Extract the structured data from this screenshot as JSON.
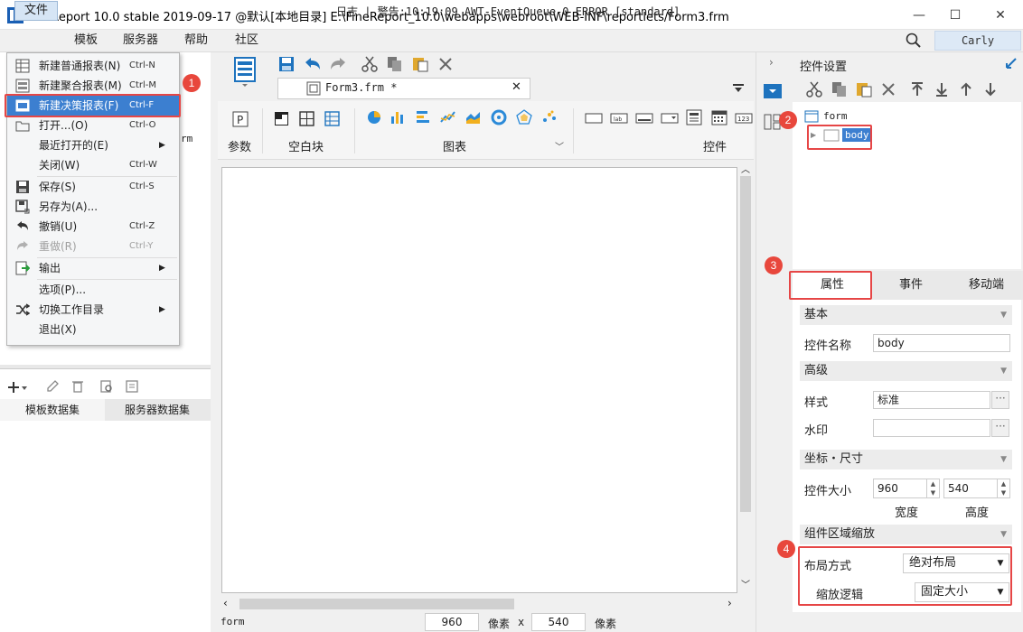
{
  "window": {
    "title": "FineReport 10.0 stable 2019-09-17 @默认[本地目录]    E:\\FineReport_10.0\\webapps\\webroot\\WEB-INF\\reportlets/Form3.frm",
    "minimize": "—",
    "maximize": "☐",
    "close": "✕"
  },
  "menubar": {
    "items": [
      "文件",
      "模板",
      "服务器",
      "帮助",
      "社区"
    ],
    "log": "日志 | 警告:10:19:09 AWT-EventQueue-0 ERROR [standard]",
    "user": "Carly"
  },
  "file_menu": {
    "items": [
      {
        "label": "新建普通报表(N)",
        "shortcut": "Ctrl-N"
      },
      {
        "label": "新建聚合报表(M)",
        "shortcut": "Ctrl-M"
      },
      {
        "label": "新建决策报表(F)",
        "shortcut": "Ctrl-F"
      },
      {
        "label": "打开...(O)",
        "shortcut": "Ctrl-O"
      },
      {
        "label": "最近打开的(E)",
        "shortcut": ""
      },
      {
        "label": "关闭(W)",
        "shortcut": "Ctrl-W"
      },
      {
        "label": "保存(S)",
        "shortcut": "Ctrl-S"
      },
      {
        "label": "另存为(A)...",
        "shortcut": ""
      },
      {
        "label": "撤销(U)",
        "shortcut": "Ctrl-Z"
      },
      {
        "label": "重做(R)",
        "shortcut": "Ctrl-Y"
      },
      {
        "label": "输出",
        "shortcut": ""
      },
      {
        "label": "选项(P)...",
        "shortcut": ""
      },
      {
        "label": "切换工作目录",
        "shortcut": ""
      },
      {
        "label": "退出(X)",
        "shortcut": ""
      }
    ],
    "peek_text": "rm"
  },
  "dataset_tabs": [
    "模板数据集",
    "服务器数据集"
  ],
  "editor": {
    "tab_label": "Form3.frm *",
    "ribbon_groups": [
      "参数",
      "空白块",
      "图表",
      "控件"
    ]
  },
  "status": {
    "name": "form",
    "width": "960",
    "unit1": "像素",
    "times": "x",
    "height": "540",
    "unit2": "像素"
  },
  "right_panel": {
    "title": "控件设置",
    "tree_root": "form",
    "tree_child": "body",
    "tabs": [
      "属性",
      "事件",
      "移动端"
    ],
    "sections": {
      "basic": "基本",
      "advanced": "高级",
      "coords": "坐标・尺寸",
      "scale": "组件区域缩放"
    },
    "props": {
      "name_label": "控件名称",
      "name_value": "body",
      "style_label": "样式",
      "style_value": "标准",
      "watermark_label": "水印",
      "watermark_value": "",
      "size_label": "控件大小",
      "width": "960",
      "height": "540",
      "width_label": "宽度",
      "height_label": "高度",
      "layout_label": "布局方式",
      "layout_value": "绝对布局",
      "zoom_label": "缩放逻辑",
      "zoom_value": "固定大小"
    }
  },
  "badges": [
    "1",
    "2",
    "3",
    "4"
  ],
  "colors": {
    "accent": "#3c7fd0",
    "highlight": "#e64646",
    "badge": "#e8473c"
  }
}
